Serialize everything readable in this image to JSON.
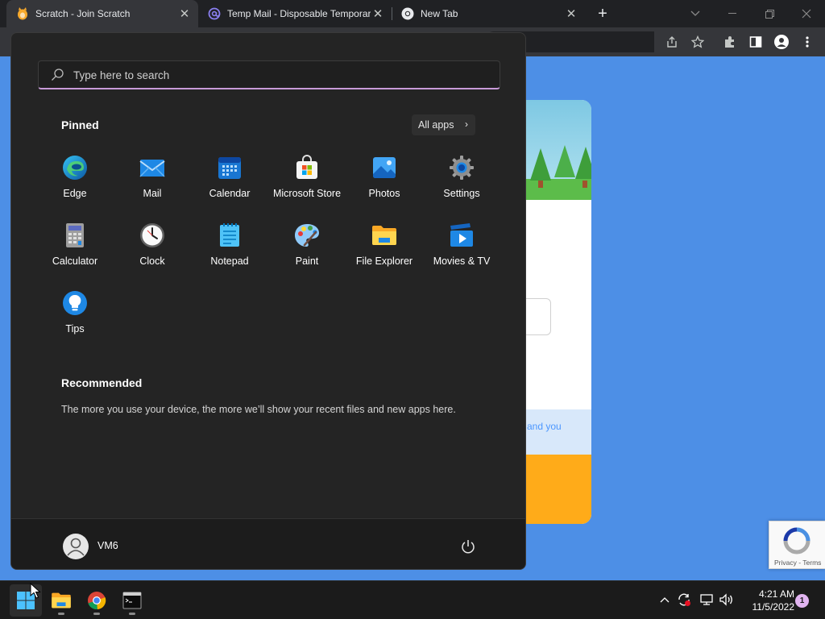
{
  "browser": {
    "tabs": [
      {
        "title": "Scratch - Join Scratch",
        "favicon": "scratch-cat-icon",
        "active": true
      },
      {
        "title": "Temp Mail - Disposable Temporary E",
        "favicon": "at-sign-icon",
        "active": false
      },
      {
        "title": "New Tab",
        "favicon": "chrome-icon",
        "active": false
      }
    ],
    "new_tab": "+",
    "page": {
      "note_text": "and you",
      "recaptcha_footer": "Privacy - Terms"
    }
  },
  "start_menu": {
    "search_placeholder": "Type here to search",
    "pinned_title": "Pinned",
    "all_apps_label": "All apps",
    "apps": [
      {
        "name": "Edge",
        "icon": "edge-icon"
      },
      {
        "name": "Mail",
        "icon": "mail-icon"
      },
      {
        "name": "Calendar",
        "icon": "calendar-icon"
      },
      {
        "name": "Microsoft Store",
        "icon": "store-icon"
      },
      {
        "name": "Photos",
        "icon": "photos-icon"
      },
      {
        "name": "Settings",
        "icon": "settings-gear-icon"
      },
      {
        "name": "Calculator",
        "icon": "calculator-icon"
      },
      {
        "name": "Clock",
        "icon": "clock-icon"
      },
      {
        "name": "Notepad",
        "icon": "notepad-icon"
      },
      {
        "name": "Paint",
        "icon": "paint-palette-icon"
      },
      {
        "name": "File Explorer",
        "icon": "folder-icon"
      },
      {
        "name": "Movies & TV",
        "icon": "movies-tv-icon"
      },
      {
        "name": "Tips",
        "icon": "lightbulb-icon"
      }
    ],
    "recommended_title": "Recommended",
    "recommended_text": "The more you use your device, the more we’ll show your recent files and new apps here.",
    "user_name": "VM6"
  },
  "taskbar": {
    "apps": [
      "start-icon",
      "file-explorer-icon",
      "chrome-icon",
      "terminal-icon"
    ],
    "time": "4:21 AM",
    "date": "11/5/2022",
    "notification_count": "1"
  },
  "colors": {
    "page_bg": "#4d8fe6",
    "start_bg": "#242424",
    "search_accent": "#c89ad8",
    "scratch_orange": "#ffab19"
  }
}
